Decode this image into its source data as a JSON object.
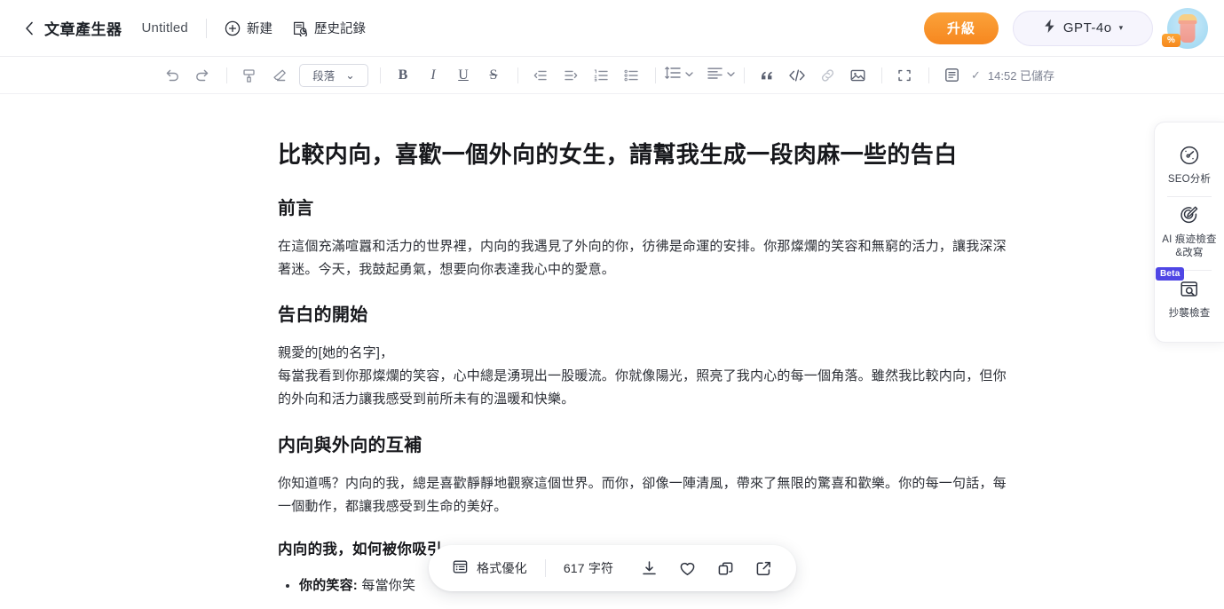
{
  "header": {
    "back_icon": "chevron-left-icon",
    "app_title": "文章產生器",
    "doc_title": "Untitled",
    "new_label": "新建",
    "history_label": "歷史記錄",
    "upgrade_label": "升級",
    "model_label": "GPT-4o",
    "model_caret": "▾",
    "avatar_badge": "%",
    "accent_orange": "#f6871f",
    "model_pill_bg": "#f6f5fd"
  },
  "toolbar": {
    "undo": "undo-icon",
    "redo": "redo-icon",
    "format_painter": "format-painter-icon",
    "clear_format": "eraser-icon",
    "block_style": "段落",
    "block_caret": "⌄",
    "bold": "B",
    "italic": "I",
    "underline": "U",
    "strike": "S",
    "outdent": "outdent-icon",
    "indent": "indent-icon",
    "ordered_list": "ordered-list-icon",
    "bullet_list": "bullet-list-icon",
    "line_height": "line-height-icon",
    "align": "align-icon",
    "quote": "quote-icon",
    "code": "code-icon",
    "link": "link-icon",
    "image": "image-icon",
    "fullscreen": "fullscreen-icon",
    "save_icon": "save-icon",
    "save_check": "✓",
    "save_status": "14:52 已儲存"
  },
  "document": {
    "title": "比較内向，喜歡一個外向的女生，請幫我生成一段肉麻一些的告白",
    "sections": [
      {
        "heading": "前言",
        "paragraph": "在這個充滿喧囂和活力的世界裡，内向的我遇見了外向的你，彷彿是命運的安排。你那燦爛的笑容和無窮的活力，讓我深深著迷。今天，我鼓起勇氣，想要向你表達我心中的愛意。"
      },
      {
        "heading": "告白的開始",
        "paragraph": "親愛的[她的名字]，\n每當我看到你那燦爛的笑容，心中總是湧現出一股暖流。你就像陽光，照亮了我内心的每一個角落。雖然我比較内向，但你的外向和活力讓我感受到前所未有的溫暖和快樂。"
      },
      {
        "heading": "内向與外向的互補",
        "paragraph": "你知道嗎？内向的我，總是喜歡靜靜地觀察這個世界。而你，卻像一陣清風，帶來了無限的驚喜和歡樂。你的每一句話，每一個動作，都讓我感受到生命的美好。"
      }
    ],
    "subheading": "内向的我，如何被你吸引",
    "bullets": [
      {
        "term": "你的笑容:",
        "text": " 每當你笑"
      }
    ]
  },
  "right_panel": {
    "items": [
      {
        "icon": "seo-gauge-icon",
        "label": "SEO分析",
        "badge": null
      },
      {
        "icon": "ai-detect-pen-icon",
        "label": "AI 痕迹檢查\n&改寫",
        "badge": null
      },
      {
        "icon": "plagiarism-search-icon",
        "label": "抄襲檢查",
        "badge": "Beta"
      }
    ],
    "beta_color": "#4f46e5"
  },
  "float_bar": {
    "format_icon": "format-list-icon",
    "format_label": "格式優化",
    "char_count": "617 字符",
    "download_icon": "download-icon",
    "favorite_icon": "heart-icon",
    "copy_icon": "copy-icon",
    "share_icon": "external-link-icon"
  }
}
